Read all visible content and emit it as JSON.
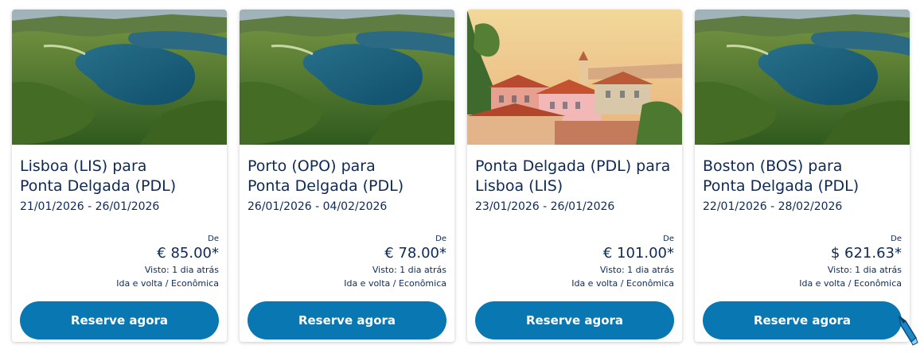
{
  "cards": [
    {
      "route_line1": "Lisboa (LIS) para",
      "route_line2": "Ponta Delgada (PDL)",
      "dates": "21/01/2026 - 26/01/2026",
      "from_label": "De",
      "price": "€ 85.00*",
      "seen": "Visto: 1 dia atrás",
      "trip_type": "Ida e volta / Econômica",
      "cta": "Reserve agora",
      "image": "azores-lagoon-photo"
    },
    {
      "route_line1": "Porto (OPO) para",
      "route_line2": "Ponta Delgada (PDL)",
      "dates": "26/01/2026 - 04/02/2026",
      "from_label": "De",
      "price": "€ 78.00*",
      "seen": "Visto: 1 dia atrás",
      "trip_type": "Ida e volta / Econômica",
      "cta": "Reserve agora",
      "image": "azores-lagoon-photo"
    },
    {
      "route_line1": "Ponta Delgada (PDL) para",
      "route_line2": "Lisboa (LIS)",
      "dates": "23/01/2026 - 26/01/2026",
      "from_label": "De",
      "price": "€ 101.00*",
      "seen": "Visto: 1 dia atrás",
      "trip_type": "Ida e volta / Econômica",
      "cta": "Reserve agora",
      "image": "lisbon-city-photo"
    },
    {
      "route_line1": "Boston (BOS) para",
      "route_line2": "Ponta Delgada (PDL)",
      "dates": "22/01/2026 - 28/02/2026",
      "from_label": "De",
      "price": "$ 621.63*",
      "seen": "Visto: 1 dia atrás",
      "trip_type": "Ida e volta / Econômica",
      "cta": "Reserve agora",
      "image": "azores-lagoon-photo"
    }
  ],
  "colors": {
    "text": "#0d2a57",
    "button": "#0877b2",
    "button_text": "#ffffff"
  }
}
